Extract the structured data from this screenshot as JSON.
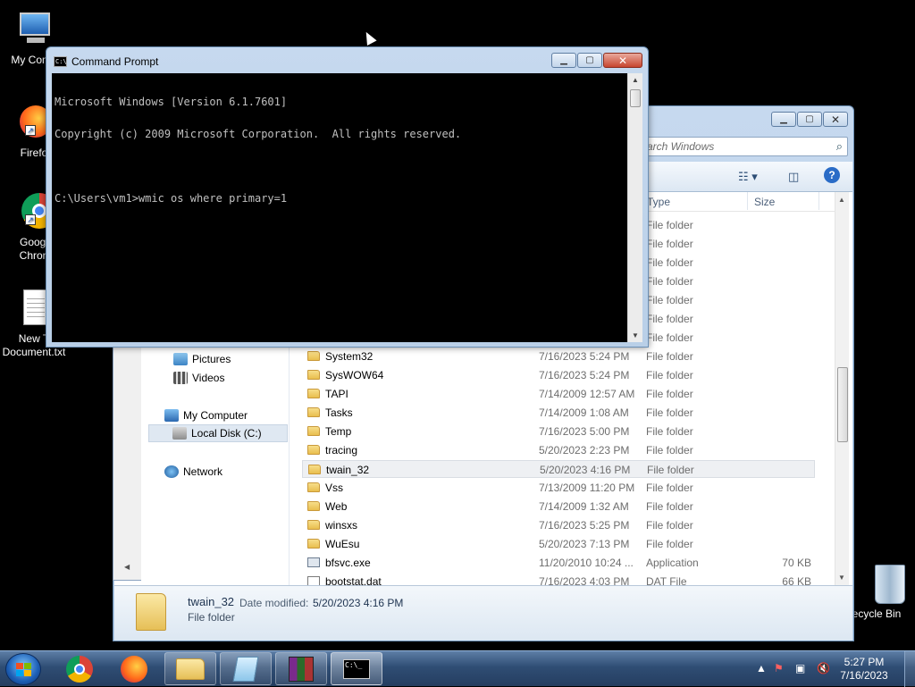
{
  "desktop": {
    "icons": [
      {
        "label": "My Comp"
      },
      {
        "label": "Firefo"
      },
      {
        "label1": "Googl",
        "label2": "Chron"
      },
      {
        "label1": "New T",
        "label2": "Document.txt"
      }
    ],
    "recycle_bin": "ecycle Bin"
  },
  "cmd": {
    "title": "Command Prompt",
    "lines": [
      "Microsoft Windows [Version 6.1.7601]",
      "Copyright (c) 2009 Microsoft Corporation.  All rights reserved.",
      "",
      "C:\\Users\\vm1>wmic os where primary=1"
    ]
  },
  "explorer": {
    "search_placeholder": "arch Windows",
    "columns": {
      "type": "Type",
      "size": "Size"
    },
    "nav": [
      {
        "label": "Pictures"
      },
      {
        "label": "Videos"
      },
      {
        "label": "My Computer"
      },
      {
        "label": "Local Disk (C:)"
      },
      {
        "label": "Network"
      }
    ],
    "partial_rows": [
      "File folder",
      "File folder",
      "File folder",
      "File folder",
      "File folder",
      "File folder",
      "File folder"
    ],
    "rows": [
      {
        "name": "System32",
        "date": "7/16/2023 5:24 PM",
        "type": "File folder",
        "size": ""
      },
      {
        "name": "SysWOW64",
        "date": "7/16/2023 5:24 PM",
        "type": "File folder",
        "size": ""
      },
      {
        "name": "TAPI",
        "date": "7/14/2009 12:57 AM",
        "type": "File folder",
        "size": ""
      },
      {
        "name": "Tasks",
        "date": "7/14/2009 1:08 AM",
        "type": "File folder",
        "size": ""
      },
      {
        "name": "Temp",
        "date": "7/16/2023 5:00 PM",
        "type": "File folder",
        "size": ""
      },
      {
        "name": "tracing",
        "date": "5/20/2023 2:23 PM",
        "type": "File folder",
        "size": ""
      },
      {
        "name": "twain_32",
        "date": "5/20/2023 4:16 PM",
        "type": "File folder",
        "size": ""
      },
      {
        "name": "Vss",
        "date": "7/13/2009 11:20 PM",
        "type": "File folder",
        "size": ""
      },
      {
        "name": "Web",
        "date": "7/14/2009 1:32 AM",
        "type": "File folder",
        "size": ""
      },
      {
        "name": "winsxs",
        "date": "7/16/2023 5:25 PM",
        "type": "File folder",
        "size": ""
      },
      {
        "name": "WuEsu",
        "date": "5/20/2023 7:13 PM",
        "type": "File folder",
        "size": ""
      },
      {
        "name": "bfsvc.exe",
        "date": "11/20/2010 10:24 ...",
        "type": "Application",
        "size": "70 KB"
      },
      {
        "name": "bootstat.dat",
        "date": "7/16/2023 4:03 PM",
        "type": "DAT File",
        "size": "66 KB"
      }
    ],
    "selected_row": 6,
    "details": {
      "name": "twain_32",
      "type": "File folder",
      "modified_label": "Date modified:",
      "modified_value": "5/20/2023 4:16 PM"
    }
  },
  "taskbar": {
    "clock_time": "5:27 PM",
    "clock_date": "7/16/2023"
  },
  "colors": {
    "accent": "#2a6cc7",
    "console_bg": "#000000",
    "console_fg": "#c0c0c0"
  }
}
